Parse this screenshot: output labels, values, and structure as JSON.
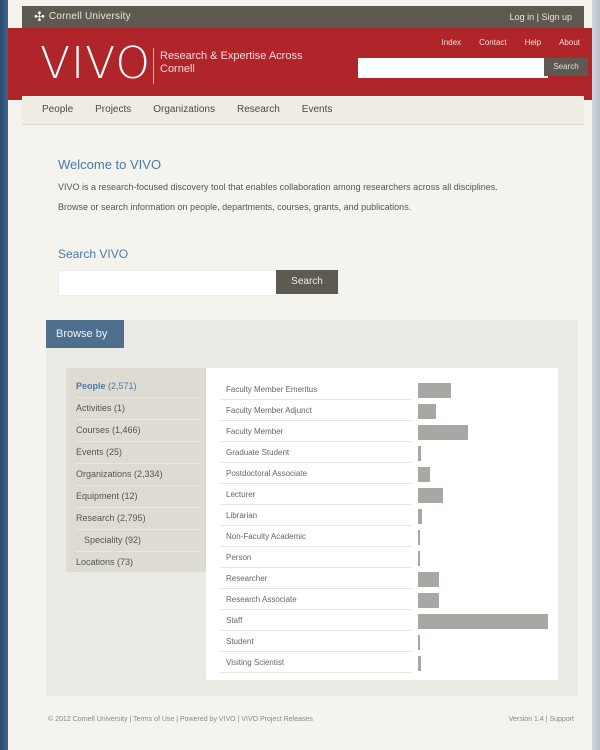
{
  "topbar": {
    "institution": "Cornell University",
    "login_label": "Log in | Sign up"
  },
  "banner": {
    "logo": "VIVO",
    "tagline": "Research & Expertise Across Cornell",
    "links": [
      "Index",
      "Contact",
      "Help",
      "About"
    ],
    "search_placeholder": "",
    "search_button": "Search"
  },
  "nav": [
    "People",
    "Projects",
    "Organizations",
    "Research",
    "Events"
  ],
  "welcome": {
    "heading": "Welcome to VIVO",
    "line1": "VIVO is a research-focused discovery tool that enables collaboration among researchers across all disciplines.",
    "line2": "Browse or search information on people, departments, courses, grants, and publications."
  },
  "search": {
    "heading": "Search VIVO",
    "placeholder": "",
    "button": "Search"
  },
  "browse": {
    "tab": "Browse by",
    "categories": [
      {
        "label": "People",
        "count": "(2,571)",
        "active": true
      },
      {
        "label": "Activities",
        "count": "(1)"
      },
      {
        "label": "Courses",
        "count": "(1,466)"
      },
      {
        "label": "Events",
        "count": "(25)"
      },
      {
        "label": "Organizations",
        "count": "(2,334)"
      },
      {
        "label": "Equipment",
        "count": "(12)"
      },
      {
        "label": "Research",
        "count": "(2,795)"
      },
      {
        "label": "Speciality",
        "count": "(92)"
      },
      {
        "label": "Locations",
        "count": "(73)"
      }
    ],
    "classes": [
      {
        "label": "Faculty Member Emeritus",
        "value": 0.22
      },
      {
        "label": "Faculty Member Adjunct",
        "value": 0.12
      },
      {
        "label": "Faculty Member",
        "value": 0.34
      },
      {
        "label": "Graduate Student",
        "value": 0.02
      },
      {
        "label": "Postdoctoral Associate",
        "value": 0.08
      },
      {
        "label": "Lecturer",
        "value": 0.17
      },
      {
        "label": "Librarian",
        "value": 0.03
      },
      {
        "label": "Non-Faculty Academic",
        "value": 0.0
      },
      {
        "label": "Person",
        "value": 0.01
      },
      {
        "label": "Researcher",
        "value": 0.14
      },
      {
        "label": "Research Associate",
        "value": 0.14
      },
      {
        "label": "Staff",
        "value": 0.88
      },
      {
        "label": "Student",
        "value": 0.01
      },
      {
        "label": "Visiting Scientist",
        "value": 0.02
      }
    ]
  },
  "footer": {
    "left": "© 2012 Cornell University | Terms of Use | Powered by VIVO | VIVO Project Releases",
    "right": "Version 1.4 | Support"
  }
}
